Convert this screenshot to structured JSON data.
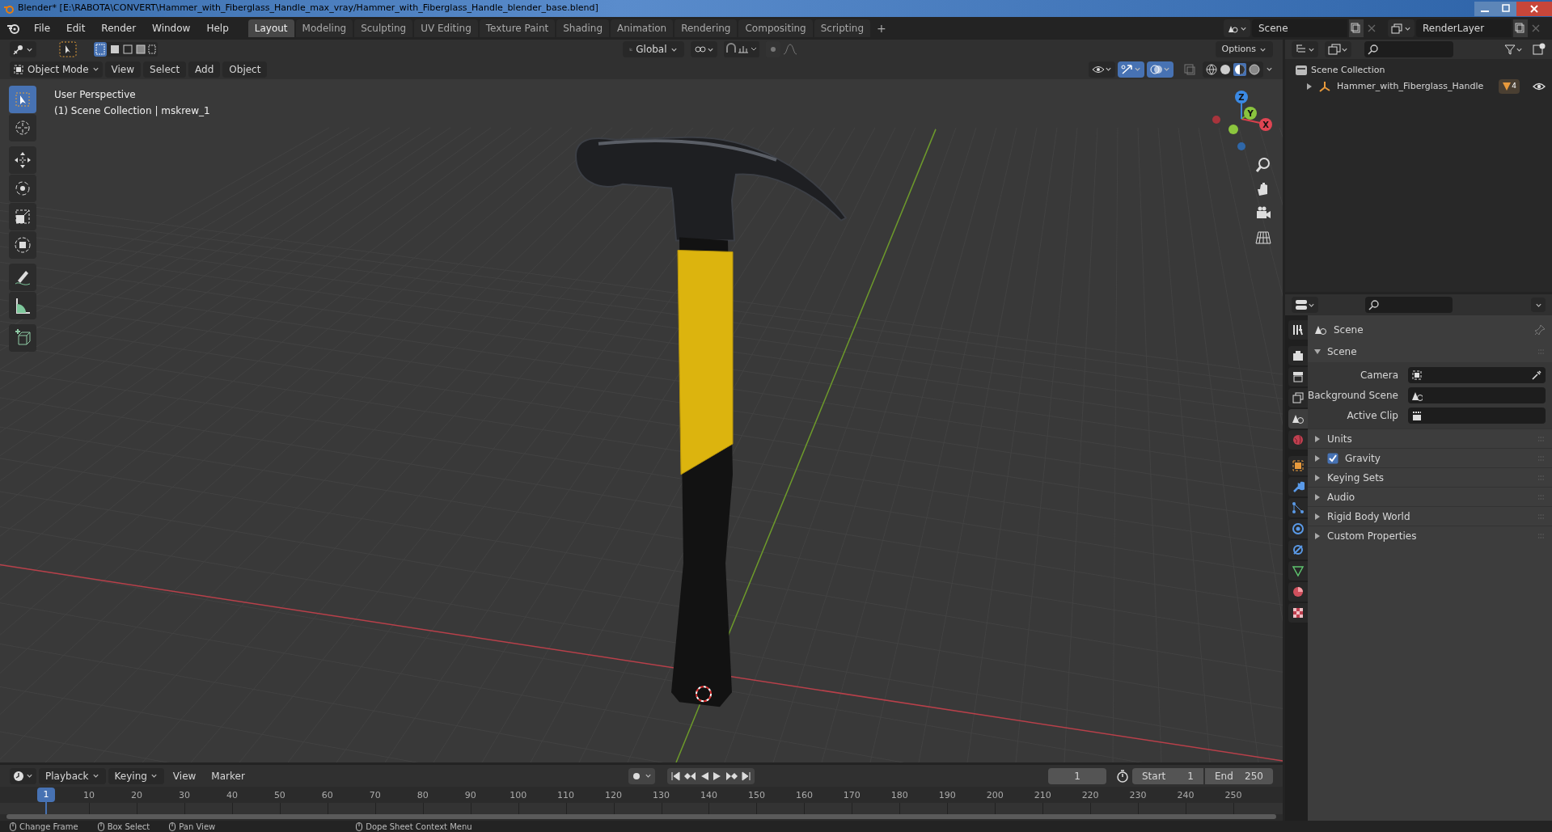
{
  "title_bar": {
    "title": "Blender* [E:\\RABOTA\\CONVERT\\Hammer_with_Fiberglass_Handle_max_vray/Hammer_with_Fiberglass_Handle_blender_base.blend]"
  },
  "menu": [
    "File",
    "Edit",
    "Render",
    "Window",
    "Help"
  ],
  "workspaces": [
    {
      "label": "Layout",
      "selected": true
    },
    {
      "label": "Modeling",
      "selected": false
    },
    {
      "label": "Sculpting",
      "selected": false
    },
    {
      "label": "UV Editing",
      "selected": false
    },
    {
      "label": "Texture Paint",
      "selected": false
    },
    {
      "label": "Shading",
      "selected": false
    },
    {
      "label": "Animation",
      "selected": false
    },
    {
      "label": "Rendering",
      "selected": false
    },
    {
      "label": "Compositing",
      "selected": false
    },
    {
      "label": "Scripting",
      "selected": false
    }
  ],
  "workspace_add": "+",
  "scene_selector": {
    "value": "Scene"
  },
  "view_layer_selector": {
    "value": "RenderLayer"
  },
  "tool_header": {
    "orientation": "Global",
    "options": "Options"
  },
  "viewport_header": {
    "mode": "Object Mode",
    "menus": [
      "View",
      "Select",
      "Add",
      "Object"
    ]
  },
  "viewport": {
    "view_name": "User Perspective",
    "collection_info": "(1) Scene Collection | mskrew_1",
    "gizmo_axes": [
      "X",
      "Y",
      "Z"
    ]
  },
  "toolbar": [
    {
      "kind": "select",
      "selected": true
    },
    {
      "kind": "cursor",
      "selected": false
    },
    {
      "kind": "move",
      "selected": false
    },
    {
      "kind": "rotate",
      "selected": false
    },
    {
      "kind": "scale",
      "selected": false
    },
    {
      "kind": "transform",
      "selected": false
    },
    {
      "kind": "annotate",
      "selected": false
    },
    {
      "kind": "measure",
      "selected": false
    },
    {
      "kind": "add-cube",
      "selected": false
    }
  ],
  "outliner": {
    "items": [
      {
        "label": "Scene Collection",
        "children": [
          {
            "label": "Hammer_with_Fiberglass_Handle",
            "expanded": false,
            "badge": "4"
          }
        ]
      }
    ]
  },
  "properties": {
    "tabs": [
      {
        "kind": "tool",
        "selected": false
      },
      {
        "kind": "render",
        "selected": false
      },
      {
        "kind": "output",
        "selected": false
      },
      {
        "kind": "view-layer",
        "selected": false
      },
      {
        "kind": "scene",
        "selected": true
      },
      {
        "kind": "world",
        "selected": false
      },
      {
        "kind": "object",
        "selected": false
      },
      {
        "kind": "modifier",
        "selected": false
      },
      {
        "kind": "particles",
        "selected": false
      },
      {
        "kind": "physics",
        "selected": false
      },
      {
        "kind": "constraints",
        "selected": false
      },
      {
        "kind": "data",
        "selected": false
      },
      {
        "kind": "material",
        "selected": false
      },
      {
        "kind": "texture",
        "selected": false
      }
    ],
    "context": "Scene",
    "panel": {
      "title": "Scene",
      "expanded": true,
      "fields": [
        {
          "label": "Camera",
          "kind": "camera"
        },
        {
          "label": "Background Scene",
          "kind": "scene"
        },
        {
          "label": "Active Clip",
          "kind": "clip"
        }
      ]
    },
    "sections": [
      {
        "label": "Units",
        "expanded": false
      },
      {
        "label": "Gravity",
        "expanded": false,
        "checked": true
      },
      {
        "label": "Keying Sets",
        "expanded": false
      },
      {
        "label": "Audio",
        "expanded": false
      },
      {
        "label": "Rigid Body World",
        "expanded": false
      },
      {
        "label": "Custom Properties",
        "expanded": false
      }
    ]
  },
  "timeline": {
    "menus": [
      "Playback",
      "Keying",
      "View",
      "Marker"
    ],
    "current_frame": "1",
    "start": {
      "label": "Start",
      "value": "1"
    },
    "end": {
      "label": "End",
      "value": "250"
    },
    "playhead": "1",
    "ticks": [
      "10",
      "20",
      "30",
      "40",
      "50",
      "60",
      "70",
      "80",
      "90",
      "100",
      "110",
      "120",
      "130",
      "140",
      "150",
      "160",
      "170",
      "180",
      "190",
      "200",
      "210",
      "220",
      "230",
      "240",
      "250"
    ]
  },
  "status_bar": [
    "Change Frame",
    "Box Select",
    "Pan View",
    "Dope Sheet Context Menu"
  ]
}
